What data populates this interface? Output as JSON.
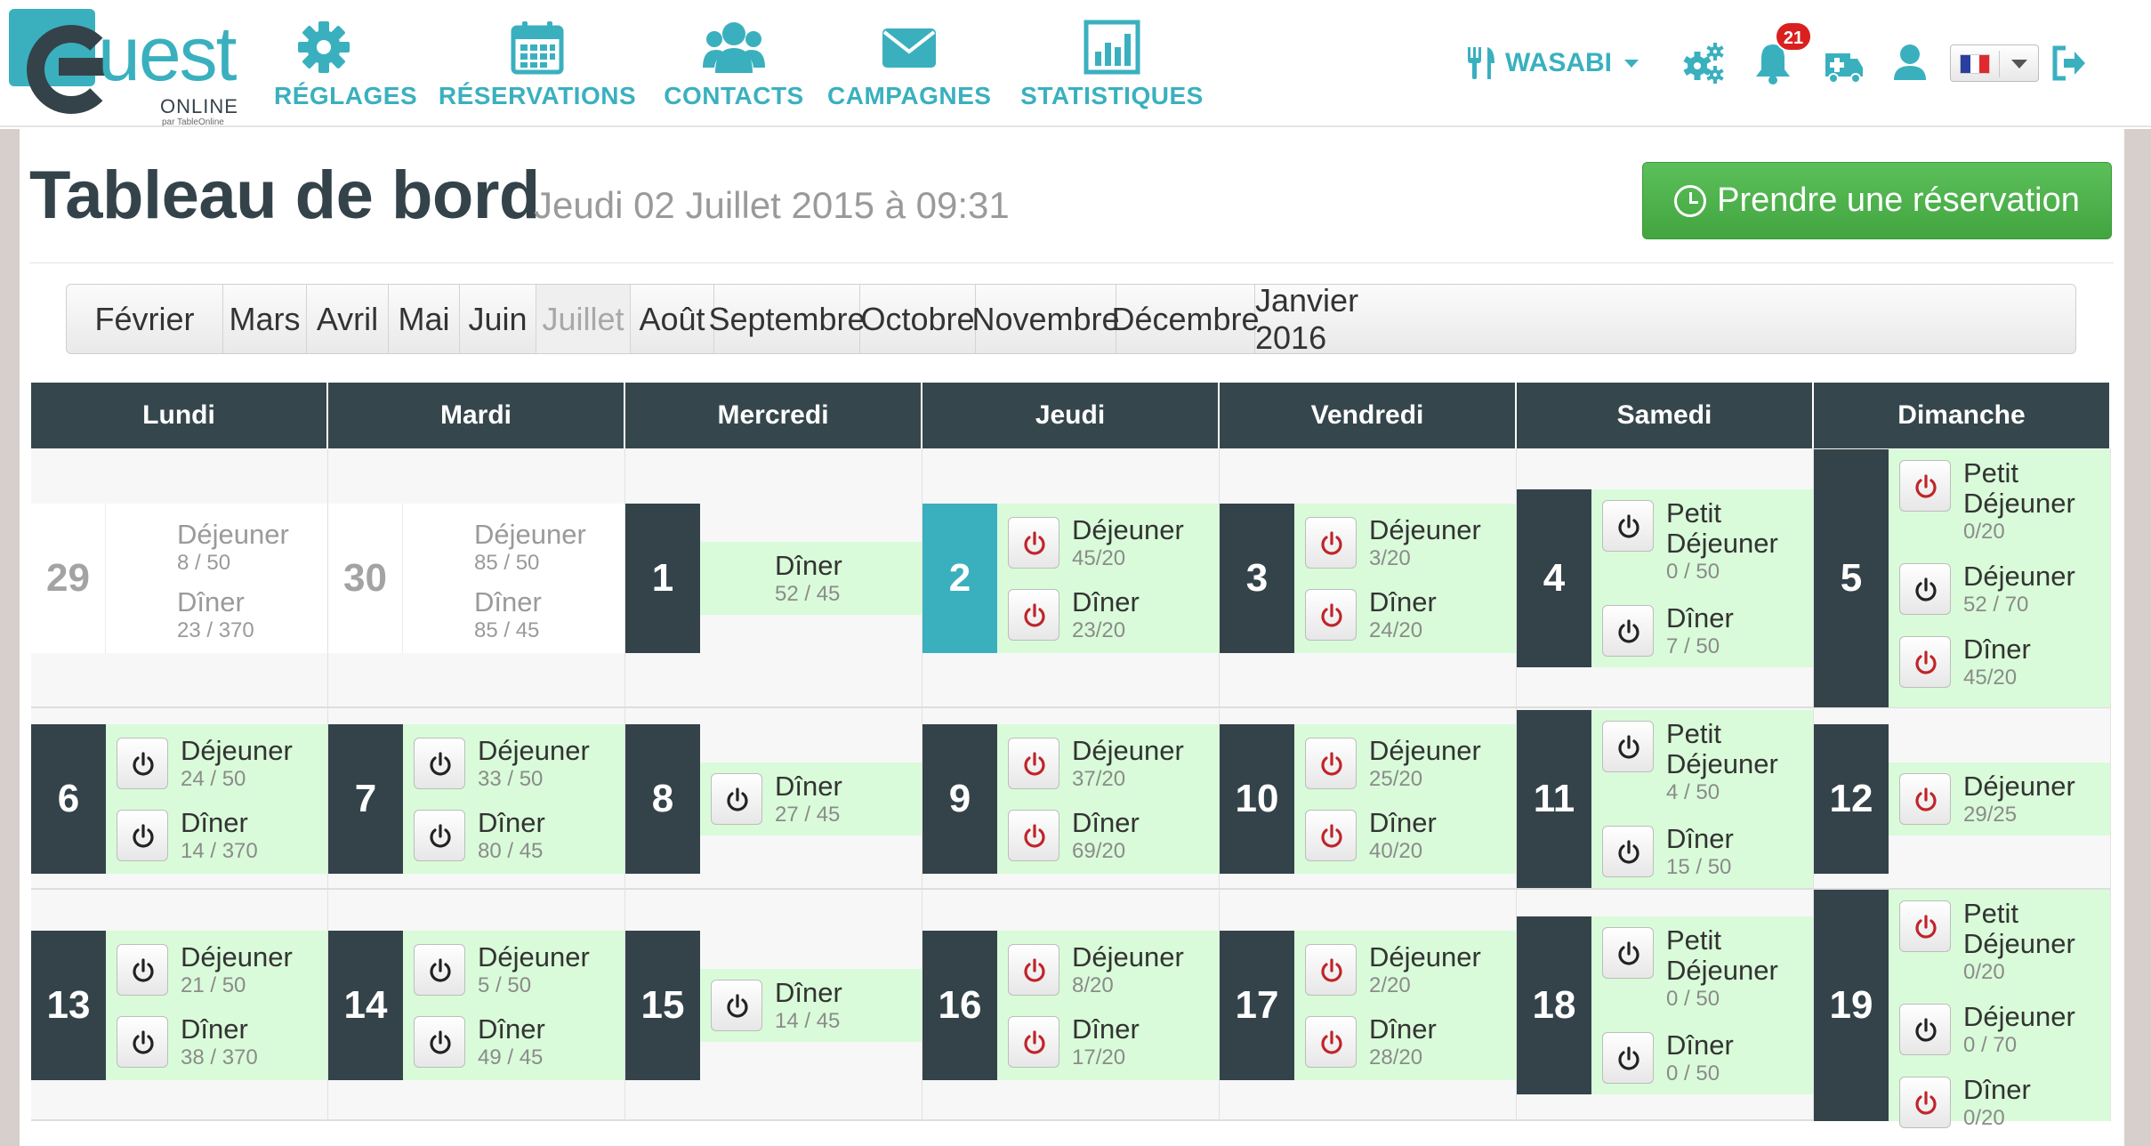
{
  "brand": {
    "name": "uest",
    "line1": "ONLINE",
    "line2": "par TableOnline"
  },
  "nav": [
    {
      "label": "RÉGLAGES",
      "icon": "gear-icon"
    },
    {
      "label": "RÉSERVATIONS",
      "icon": "calendar-icon"
    },
    {
      "label": "CONTACTS",
      "icon": "users-icon"
    },
    {
      "label": "CAMPAGNES",
      "icon": "envelope-icon"
    },
    {
      "label": "STATISTIQUES",
      "icon": "bar-chart-icon"
    }
  ],
  "restaurant": {
    "label": "WASABI",
    "icon": "cutlery-icon"
  },
  "toolbar": {
    "notifications_count": "21"
  },
  "language": {
    "selected": "fr"
  },
  "page": {
    "title": "Tableau de bord",
    "subtitle": "Jeudi 02 Juillet 2015 à 09:31",
    "cta_label": "Prendre une réservation"
  },
  "months": [
    "Février",
    "Mars",
    "Avril",
    "Mai",
    "Juin",
    "Juillet",
    "Août",
    "Septembre",
    "Octobre",
    "Novembre",
    "Décembre",
    "Janvier 2016"
  ],
  "active_month": "Juillet",
  "weekdays": [
    "Lundi",
    "Mardi",
    "Mercredi",
    "Jeudi",
    "Vendredi",
    "Samedi",
    "Dimanche"
  ],
  "calendar": [
    [
      {
        "day": "29",
        "state": "past",
        "services": [
          {
            "name": "Déjeuner",
            "count": "8 / 50"
          },
          {
            "name": "Dîner",
            "count": "23 / 370"
          }
        ]
      },
      {
        "day": "30",
        "state": "past",
        "services": [
          {
            "name": "Déjeuner",
            "count": "85 / 50"
          },
          {
            "name": "Dîner",
            "count": "85 / 45"
          }
        ]
      },
      {
        "day": "1",
        "state": "past-open",
        "services": [
          {
            "name": "Dîner",
            "count": "52 / 45"
          }
        ]
      },
      {
        "day": "2",
        "state": "today",
        "services": [
          {
            "name": "Déjeuner",
            "count": "45/20",
            "power": "red"
          },
          {
            "name": "Dîner",
            "count": "23/20",
            "power": "red"
          }
        ]
      },
      {
        "day": "3",
        "state": "open",
        "services": [
          {
            "name": "Déjeuner",
            "count": "3/20",
            "power": "red"
          },
          {
            "name": "Dîner",
            "count": "24/20",
            "power": "red"
          }
        ]
      },
      {
        "day": "4",
        "state": "open",
        "services": [
          {
            "name": "Petit Déjeuner",
            "count": "0 / 50",
            "power": "dark"
          },
          {
            "name": "Dîner",
            "count": "7 / 50",
            "power": "dark"
          }
        ]
      },
      {
        "day": "5",
        "state": "open",
        "services": [
          {
            "name": "Petit Déjeuner",
            "count": "0/20",
            "power": "red"
          },
          {
            "name": "Déjeuner",
            "count": "52 / 70",
            "power": "dark"
          },
          {
            "name": "Dîner",
            "count": "45/20",
            "power": "red"
          }
        ]
      }
    ],
    [
      {
        "day": "6",
        "state": "open",
        "services": [
          {
            "name": "Déjeuner",
            "count": "24 / 50",
            "power": "dark"
          },
          {
            "name": "Dîner",
            "count": "14 / 370",
            "power": "dark"
          }
        ]
      },
      {
        "day": "7",
        "state": "open",
        "services": [
          {
            "name": "Déjeuner",
            "count": "33 / 50",
            "power": "dark"
          },
          {
            "name": "Dîner",
            "count": "80 / 45",
            "power": "dark"
          }
        ]
      },
      {
        "day": "8",
        "state": "open",
        "services": [
          {
            "name": "Dîner",
            "count": "27 / 45",
            "power": "dark"
          }
        ]
      },
      {
        "day": "9",
        "state": "open",
        "services": [
          {
            "name": "Déjeuner",
            "count": "37/20",
            "power": "red"
          },
          {
            "name": "Dîner",
            "count": "69/20",
            "power": "red"
          }
        ]
      },
      {
        "day": "10",
        "state": "open",
        "services": [
          {
            "name": "Déjeuner",
            "count": "25/20",
            "power": "red"
          },
          {
            "name": "Dîner",
            "count": "40/20",
            "power": "red"
          }
        ]
      },
      {
        "day": "11",
        "state": "open",
        "services": [
          {
            "name": "Petit Déjeuner",
            "count": "4 / 50",
            "power": "dark"
          },
          {
            "name": "Dîner",
            "count": "15 / 50",
            "power": "dark"
          }
        ]
      },
      {
        "day": "12",
        "state": "open",
        "services": [
          {
            "name": "Déjeuner",
            "count": "29/25",
            "power": "red"
          }
        ]
      }
    ],
    [
      {
        "day": "13",
        "state": "open",
        "services": [
          {
            "name": "Déjeuner",
            "count": "21 / 50",
            "power": "dark"
          },
          {
            "name": "Dîner",
            "count": "38 / 370",
            "power": "dark"
          }
        ]
      },
      {
        "day": "14",
        "state": "open",
        "services": [
          {
            "name": "Déjeuner",
            "count": "5 / 50",
            "power": "dark"
          },
          {
            "name": "Dîner",
            "count": "49 / 45",
            "power": "dark"
          }
        ]
      },
      {
        "day": "15",
        "state": "open",
        "services": [
          {
            "name": "Dîner",
            "count": "14 / 45",
            "power": "dark"
          }
        ]
      },
      {
        "day": "16",
        "state": "open",
        "services": [
          {
            "name": "Déjeuner",
            "count": "8/20",
            "power": "red"
          },
          {
            "name": "Dîner",
            "count": "17/20",
            "power": "red"
          }
        ]
      },
      {
        "day": "17",
        "state": "open",
        "services": [
          {
            "name": "Déjeuner",
            "count": "2/20",
            "power": "red"
          },
          {
            "name": "Dîner",
            "count": "28/20",
            "power": "red"
          }
        ]
      },
      {
        "day": "18",
        "state": "open",
        "services": [
          {
            "name": "Petit Déjeuner",
            "count": "0 / 50",
            "power": "dark"
          },
          {
            "name": "Dîner",
            "count": "0 / 50",
            "power": "dark"
          }
        ]
      },
      {
        "day": "19",
        "state": "open",
        "services": [
          {
            "name": "Petit Déjeuner",
            "count": "0/20",
            "power": "red"
          },
          {
            "name": "Déjeuner",
            "count": "0 / 70",
            "power": "dark"
          },
          {
            "name": "Dîner",
            "count": "0/20",
            "power": "red"
          }
        ]
      }
    ]
  ],
  "colors": {
    "accent": "#3ab0bf",
    "dark": "#34434a",
    "open_bg": "#d9fbd9",
    "power_red": "#c0242a",
    "cta_green": "#4cae4c"
  }
}
